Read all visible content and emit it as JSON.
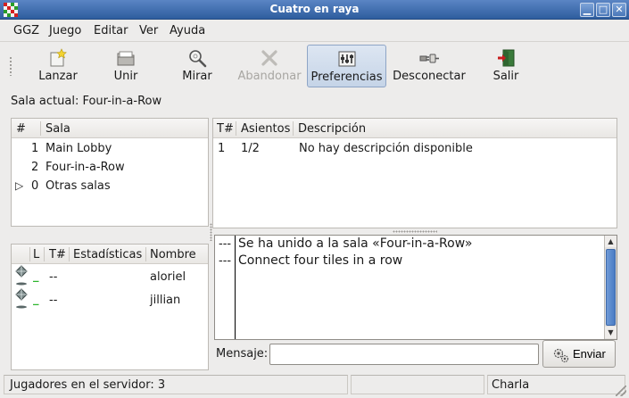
{
  "window": {
    "title": "Cuatro en raya"
  },
  "menu": {
    "items": [
      "GGZ",
      "Juego",
      "Editar",
      "Ver",
      "Ayuda"
    ]
  },
  "toolbar": {
    "buttons": [
      {
        "label": "Lanzar",
        "icon": "launch-star-icon",
        "state": "normal"
      },
      {
        "label": "Unir",
        "icon": "join-folder-icon",
        "state": "normal"
      },
      {
        "label": "Mirar",
        "icon": "watch-magnifier-icon",
        "state": "normal"
      },
      {
        "label": "Abandonar",
        "icon": "leave-x-icon",
        "state": "disabled"
      },
      {
        "label": "Preferencias",
        "icon": "preferences-icon",
        "state": "active"
      },
      {
        "label": "Desconectar",
        "icon": "disconnect-plug-icon",
        "state": "normal"
      },
      {
        "label": "Salir",
        "icon": "exit-door-icon",
        "state": "normal"
      }
    ]
  },
  "current_room": "Sala actual: Four-in-a-Row",
  "rooms": {
    "headers": [
      "#",
      "Sala"
    ],
    "rows": [
      {
        "num": "1",
        "name": "Main Lobby",
        "expander": ""
      },
      {
        "num": "2",
        "name": "Four-in-a-Row",
        "expander": ""
      },
      {
        "num": "0",
        "name": "Otras salas",
        "expander": "▷"
      }
    ]
  },
  "tables": {
    "headers": [
      "T#",
      "Asientos",
      "Descripción"
    ],
    "rows": [
      {
        "table": "1",
        "seats": "1/2",
        "description": "No hay descripción disponible"
      }
    ]
  },
  "players": {
    "headers": [
      "L",
      "T#",
      "Estadísticas",
      "Nombre"
    ],
    "rows": [
      {
        "lag": "_",
        "table": "--",
        "name": "aloriel"
      },
      {
        "lag": "_",
        "table": "--",
        "name": "jillian"
      }
    ]
  },
  "chat": {
    "lines": [
      {
        "prefix": "---",
        "text": "Se ha unido a la sala «Four-in-a-Row»"
      },
      {
        "prefix": "---",
        "text": "Connect four tiles in a row"
      }
    ],
    "message_label": "Mensaje:",
    "message_value": "",
    "send_label": "Enviar"
  },
  "status": {
    "players_on_server": "Jugadores en el servidor: 3",
    "mode": "Charla"
  },
  "colors": {
    "title_bar": "#3d6aab",
    "active_button": "#c5d4e7",
    "lag_green": "#2db52d",
    "scrollbar": "#4a7cc4"
  }
}
